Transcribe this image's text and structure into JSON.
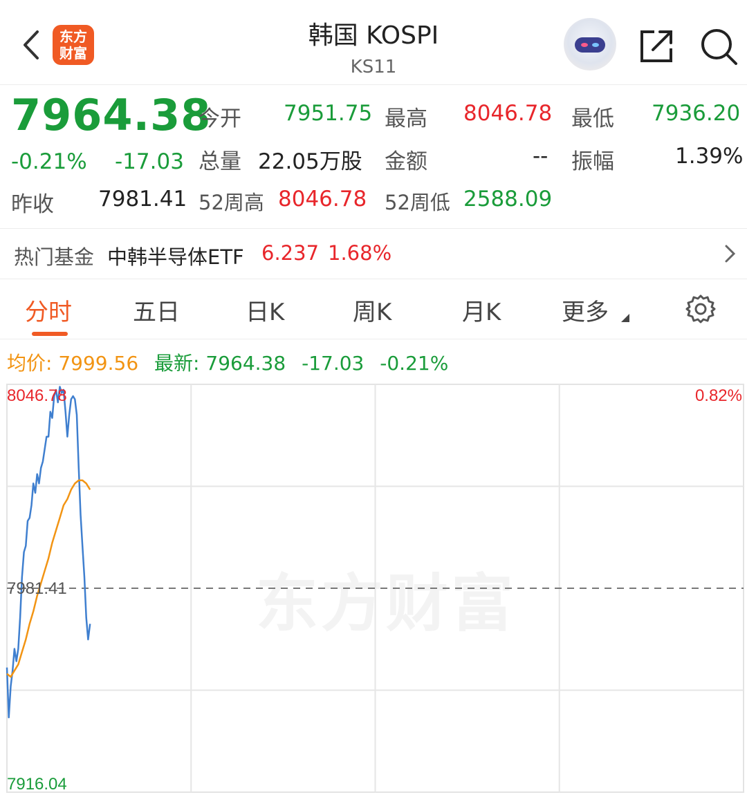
{
  "header": {
    "logo_text_line1": "东方",
    "logo_text_line2": "财富",
    "title": "韩国 KOSPI",
    "subtitle": "KS11"
  },
  "quote": {
    "price": "7964.38",
    "change_pct": "-0.21%",
    "change": "-17.03",
    "prev_close_label": "昨收",
    "prev_close": "7981.41",
    "open_label": "今开",
    "open": "7951.75",
    "high_label": "最高",
    "high": "8046.78",
    "low_label": "最低",
    "low": "7936.20",
    "volume_label": "总量",
    "volume": "22.05万股",
    "amount_label": "金额",
    "amount": "--",
    "amplitude_label": "振幅",
    "amplitude": "1.39%",
    "w52_high_label": "52周高",
    "w52_high": "8046.78",
    "w52_low_label": "52周低",
    "w52_low": "2588.09"
  },
  "fund": {
    "label": "热门基金",
    "name": "中韩半导体ETF",
    "price": "6.237",
    "pct": "1.68%"
  },
  "tabs": [
    "分时",
    "五日",
    "日K",
    "周K",
    "月K",
    "更多"
  ],
  "active_tab": 0,
  "legend": {
    "avg_label": "均价:",
    "avg_value": "7999.56",
    "latest_label": "最新:",
    "latest_value": "7964.38",
    "change": "-17.03",
    "change_pct": "-0.21%"
  },
  "chart_data": {
    "type": "line",
    "y_top_label": "8046.78",
    "y_mid_label": "7981.41",
    "y_bottom_label": "7916.04",
    "right_top_label": "0.82%",
    "ylim": [
      7916.04,
      8046.78
    ],
    "reference": 7981.41,
    "x_total_minutes": 390,
    "series": [
      {
        "role": "price",
        "x": [
          0,
          1,
          2,
          3,
          4,
          5,
          6,
          7,
          8,
          9,
          10,
          11,
          12,
          13,
          14,
          15,
          16,
          17,
          18,
          19,
          20,
          21,
          22,
          23,
          24,
          25,
          26,
          27,
          28,
          29,
          30,
          31,
          32,
          33,
          34,
          35,
          36,
          37,
          38,
          39,
          40,
          41,
          42,
          43,
          44
        ],
        "y": [
          7956,
          7940,
          7950,
          7955,
          7962,
          7958,
          7962,
          7972,
          7985,
          7993,
          7995,
          8003,
          8004,
          8008,
          8015,
          8012,
          8018,
          8015,
          8020,
          8022,
          8026,
          8030,
          8030,
          8038,
          8036,
          8043,
          8045,
          8041,
          8046,
          8044,
          8045,
          8038,
          8030,
          8037,
          8042,
          8043,
          8042,
          8037,
          8020,
          8005,
          7995,
          7985,
          7972,
          7965,
          7970
        ]
      },
      {
        "role": "average",
        "x": [
          0,
          2,
          4,
          6,
          8,
          10,
          12,
          14,
          16,
          18,
          20,
          22,
          24,
          26,
          28,
          30,
          32,
          34,
          36,
          38,
          40,
          42,
          44
        ],
        "y": [
          7954,
          7953,
          7955,
          7957,
          7961,
          7965,
          7970,
          7974,
          7979,
          7983,
          7987,
          7991,
          7996,
          8000,
          8004,
          8008,
          8010,
          8013,
          8015,
          8016,
          8016,
          8015,
          8013
        ]
      }
    ],
    "colors": {
      "price": "#3f7fcf",
      "average": "#f29413"
    }
  },
  "watermark": "东方财富"
}
